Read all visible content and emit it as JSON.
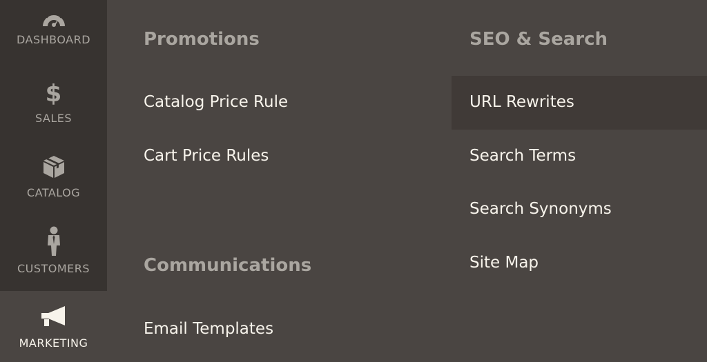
{
  "sidebar": {
    "items": [
      {
        "id": "dashboard",
        "label": "DASHBOARD",
        "icon": "speedometer-icon"
      },
      {
        "id": "sales",
        "label": "SALES",
        "icon": "dollar-icon",
        "glyph": "$"
      },
      {
        "id": "catalog",
        "label": "CATALOG",
        "icon": "box-icon"
      },
      {
        "id": "customers",
        "label": "CUSTOMERS",
        "icon": "person-icon"
      },
      {
        "id": "marketing",
        "label": "MARKETING",
        "icon": "megaphone-icon",
        "active": true
      }
    ]
  },
  "menu": {
    "promotions": {
      "title": "Promotions",
      "links": [
        "Catalog Price Rule",
        "Cart Price Rules"
      ]
    },
    "communications": {
      "title": "Communications",
      "links": [
        "Email Templates"
      ]
    },
    "seo": {
      "title": "SEO & Search",
      "links": [
        "URL Rewrites",
        "Search Terms",
        "Search Synonyms",
        "Site Map"
      ],
      "hovered": "URL Rewrites"
    }
  },
  "colors": {
    "background": "#4a4542",
    "sidebar_dark": "#373330",
    "hover": "#403a37",
    "title": "#aaa6a0",
    "link": "#f7f3eb"
  }
}
